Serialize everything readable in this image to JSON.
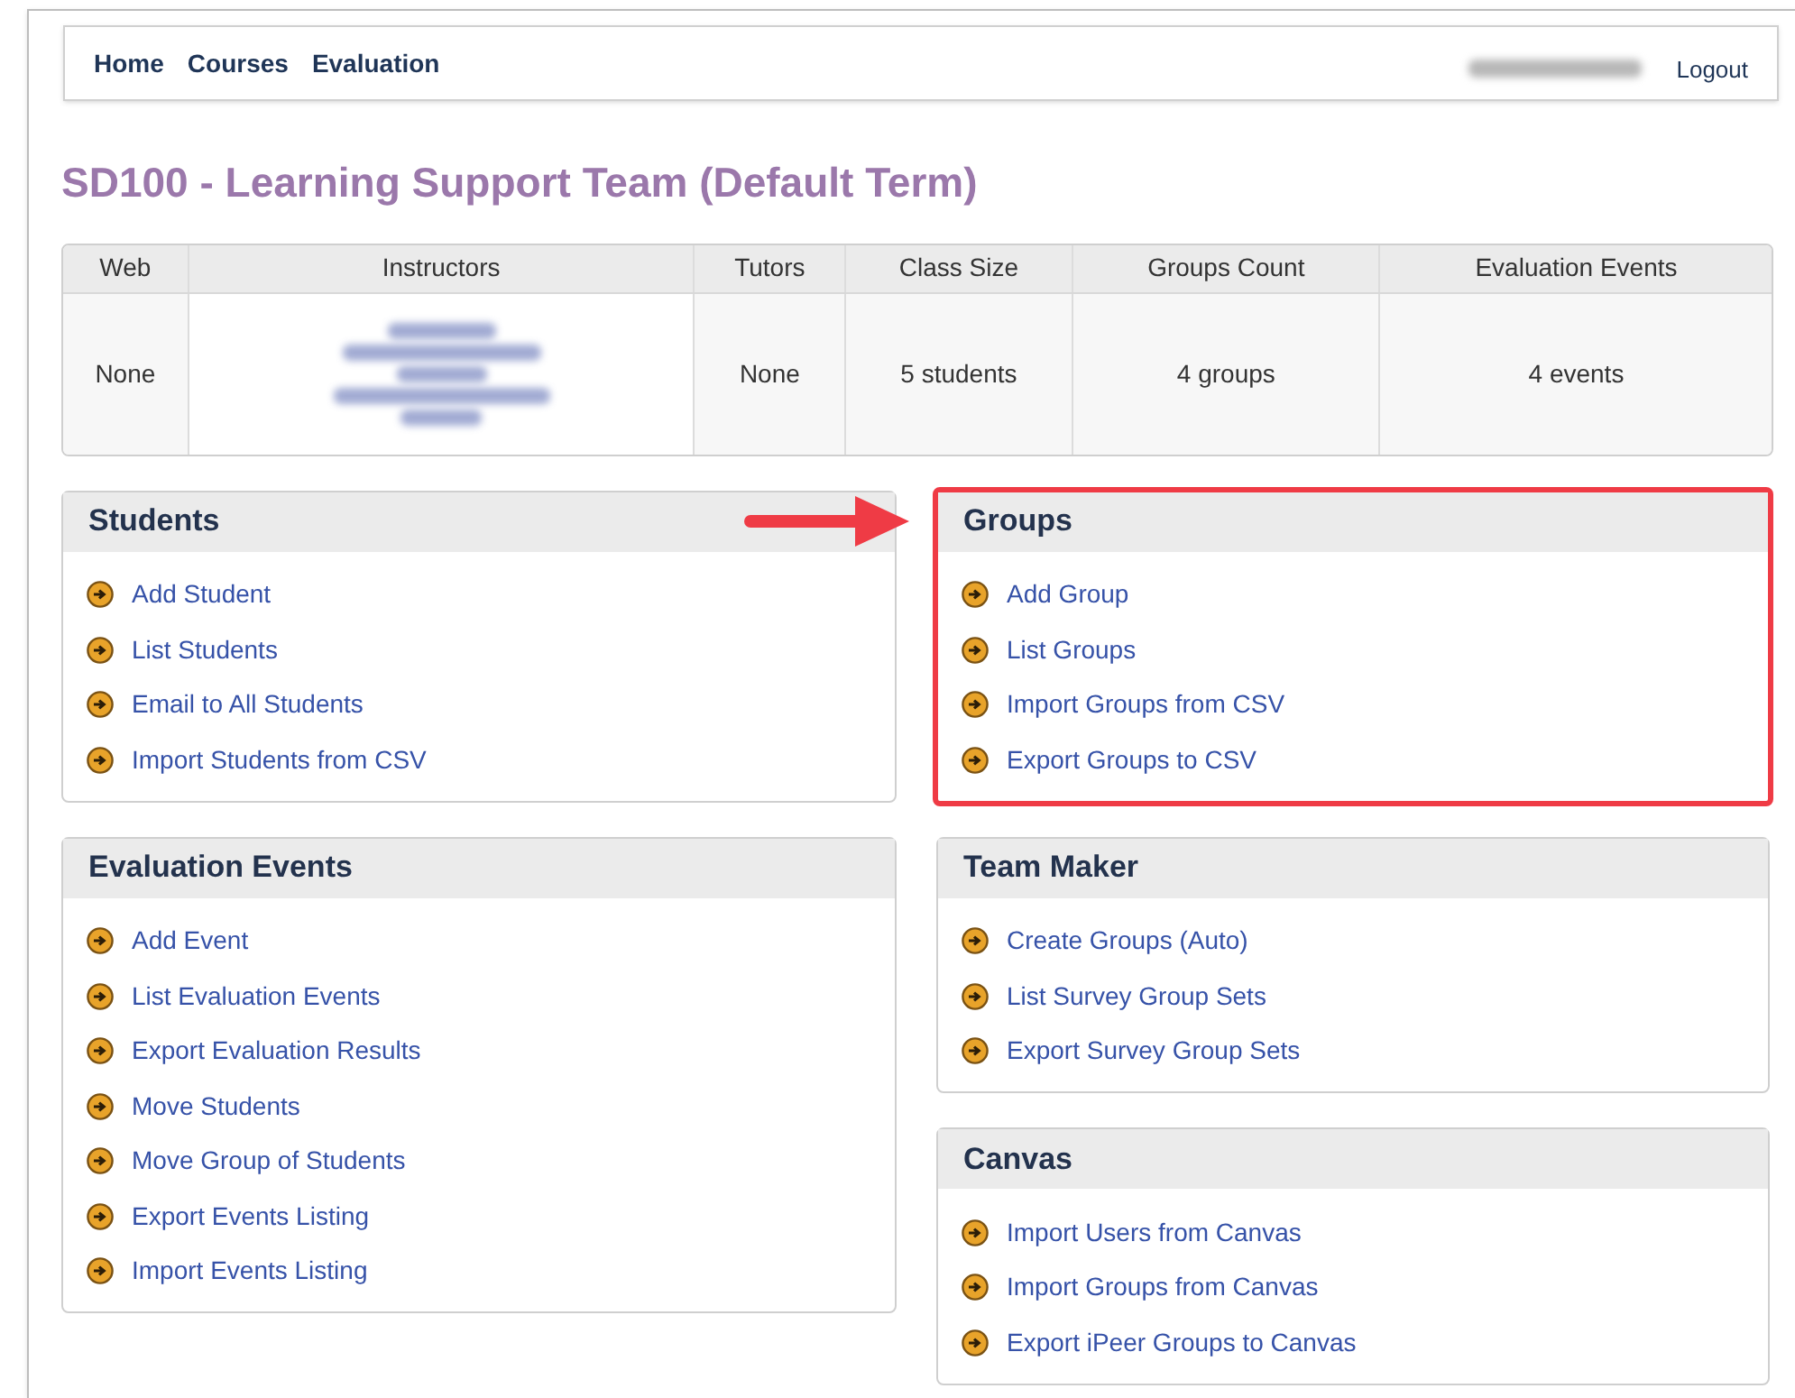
{
  "nav": {
    "links": [
      {
        "label": "Home"
      },
      {
        "label": "Courses"
      },
      {
        "label": "Evaluation"
      }
    ],
    "user": {
      "redacted": true
    },
    "logout": "Logout"
  },
  "title": "SD100 - Learning Support Team (Default Term)",
  "summary": {
    "columns": [
      "Web",
      "Instructors",
      "Tutors",
      "Class Size",
      "Groups Count",
      "Evaluation Events"
    ],
    "row": [
      {
        "text": "None"
      },
      {
        "redacted": true
      },
      {
        "text": "None"
      },
      {
        "text": "5 students"
      },
      {
        "text": "4 groups"
      },
      {
        "text": "4 events"
      }
    ]
  },
  "left_panels": [
    {
      "title": "Students",
      "highlighted": false,
      "links": [
        "Add Student",
        "List Students",
        "Email to All Students",
        "Import Students from CSV"
      ]
    },
    {
      "title": "Evaluation Events",
      "highlighted": false,
      "links": [
        "Add Event",
        "List Evaluation Events",
        "Export Evaluation Results",
        "Move Students",
        "Move Group of Students",
        "Export Events Listing",
        "Import Events Listing"
      ]
    }
  ],
  "right_panels": [
    {
      "title": "Groups",
      "highlighted": true,
      "links": [
        "Add Group",
        "List Groups",
        "Import Groups from CSV",
        "Export Groups to CSV"
      ]
    },
    {
      "title": "Team Maker",
      "highlighted": false,
      "links": [
        "Create Groups (Auto)",
        "List Survey Group Sets",
        "Export Survey Group Sets"
      ]
    },
    {
      "title": "Canvas",
      "highlighted": false,
      "links": [
        "Import Users from Canvas",
        "Import Groups from Canvas",
        "Export iPeer Groups to Canvas"
      ]
    }
  ]
}
